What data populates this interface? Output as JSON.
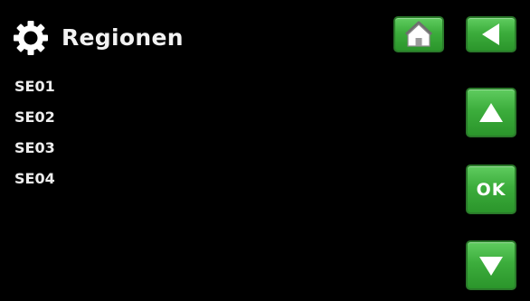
{
  "header": {
    "title": "Regionen",
    "icon": "gear-icon"
  },
  "regions": {
    "items": [
      "SE01",
      "SE02",
      "SE03",
      "SE04"
    ]
  },
  "nav": {
    "home_icon": "home-icon",
    "back_icon": "back-arrow-icon",
    "up_icon": "up-arrow-icon",
    "ok_label": "OK",
    "down_icon": "down-arrow-icon"
  },
  "colors": {
    "background": "#000000",
    "button_green": "#3cad3c",
    "text": "#ececec"
  }
}
